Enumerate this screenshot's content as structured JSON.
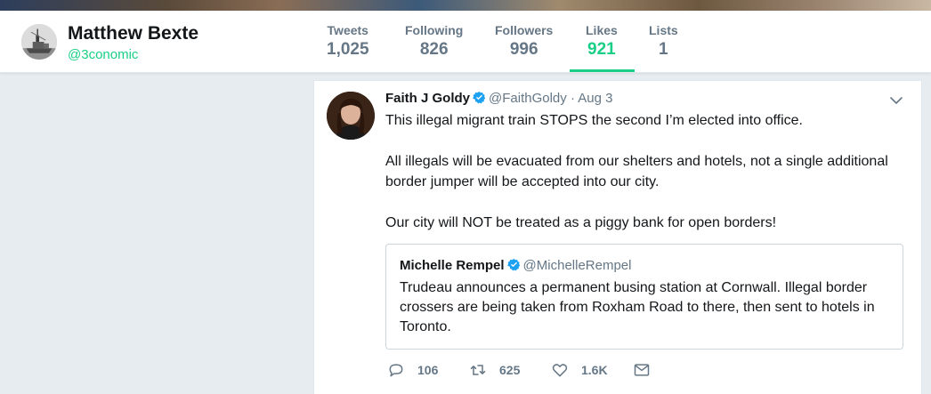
{
  "profile": {
    "name": "Matthew Bexte",
    "handle": "@3conomic",
    "avatar_icon": "ship-avatar"
  },
  "stats": [
    {
      "label": "Tweets",
      "value": "1,025",
      "active": false
    },
    {
      "label": "Following",
      "value": "826",
      "active": false
    },
    {
      "label": "Followers",
      "value": "996",
      "active": false
    },
    {
      "label": "Likes",
      "value": "921",
      "active": true
    },
    {
      "label": "Lists",
      "value": "1",
      "active": false
    }
  ],
  "tweet": {
    "author": "Faith J Goldy",
    "handle": "@FaithGoldy",
    "separator": "·",
    "date": "Aug 3",
    "verified": true,
    "paragraphs": [
      "This illegal migrant train STOPS the second I’m elected into office.",
      "All illegals will be evacuated from our shelters and hotels, not a single additional border jumper will be accepted into our city.",
      "Our city will NOT be treated as a piggy bank for open borders!"
    ],
    "quote": {
      "author": "Michelle Rempel",
      "handle": "@MichelleRempel",
      "verified": true,
      "text": "Trudeau announces a permanent busing station at Cornwall. Illegal border crossers are being taken from Roxham Road to there, then sent to hotels in Toronto."
    },
    "actions": {
      "reply_count": "106",
      "retweet_count": "625",
      "like_count": "1.6K"
    }
  },
  "colors": {
    "accent": "#19cf86",
    "verified": "#1da1f2",
    "muted": "#657786",
    "background": "#e6ecf0"
  },
  "icons": [
    "chevron-down-icon",
    "verified-icon",
    "reply-icon",
    "retweet-icon",
    "like-icon",
    "direct-message-icon"
  ]
}
